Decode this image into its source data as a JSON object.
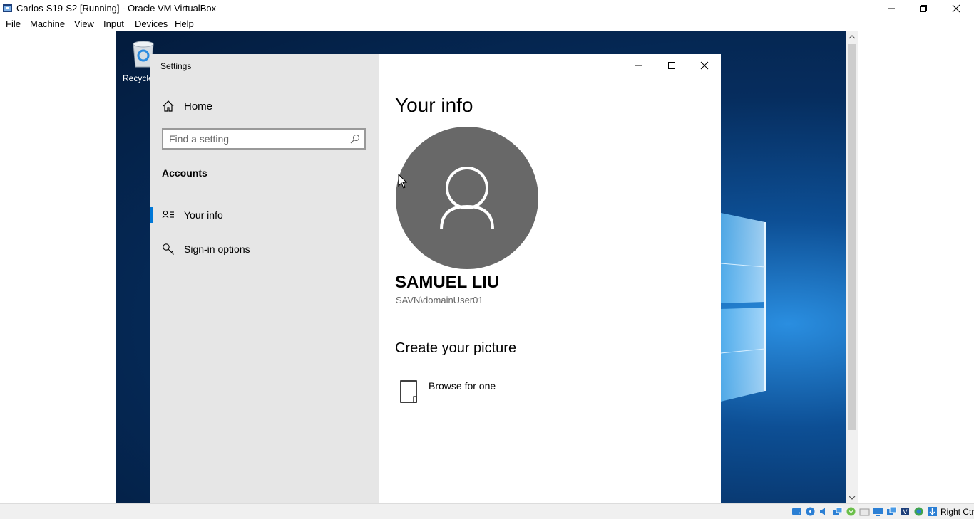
{
  "host_window": {
    "title": "Carlos-S19-S2 [Running] - Oracle VM VirtualBox",
    "app_icon": "virtualbox-icon",
    "controls": [
      "minimize-icon",
      "restore-icon",
      "close-icon"
    ]
  },
  "menubar": {
    "items": [
      {
        "label": "File"
      },
      {
        "label": "Machine"
      },
      {
        "label": "View"
      },
      {
        "label": "Input"
      },
      {
        "label": "Devices"
      },
      {
        "label": "Help"
      }
    ]
  },
  "desktop": {
    "recycle_bin_label": "Recycle"
  },
  "settings": {
    "window_title": "Settings",
    "nav": {
      "home_label": "Home",
      "search_placeholder": "Find a setting",
      "section_heading": "Accounts",
      "items": [
        {
          "label": "Your info",
          "icon": "contact-card-icon",
          "selected": true
        },
        {
          "label": "Sign-in options",
          "icon": "key-icon",
          "selected": false
        }
      ]
    },
    "content": {
      "title": "Your info",
      "avatar_icon": "user-avatar-icon",
      "user_name": "SAMUEL LIU",
      "account": "SAVN\\domainUser01",
      "create_heading": "Create your picture",
      "browse_label": "Browse for one",
      "browse_icon": "file-icon"
    },
    "controls": [
      "minimize-icon",
      "maximize-icon",
      "close-icon"
    ]
  },
  "statusbar": {
    "host_key": "Right Ctrl",
    "icons": [
      "hard-disk-icon",
      "optical-drive-icon",
      "audio-icon",
      "network-icon",
      "usb-icon",
      "shared-folders-icon",
      "display-icon",
      "video-capture-icon",
      "cpu-icon",
      "mouse-integration-icon",
      "keyboard-icon"
    ]
  },
  "colors": {
    "accent": "#0078d7",
    "nav_background": "#e6e6e6",
    "avatar_background": "#686868",
    "desktop_blue": "#0d4f95"
  }
}
